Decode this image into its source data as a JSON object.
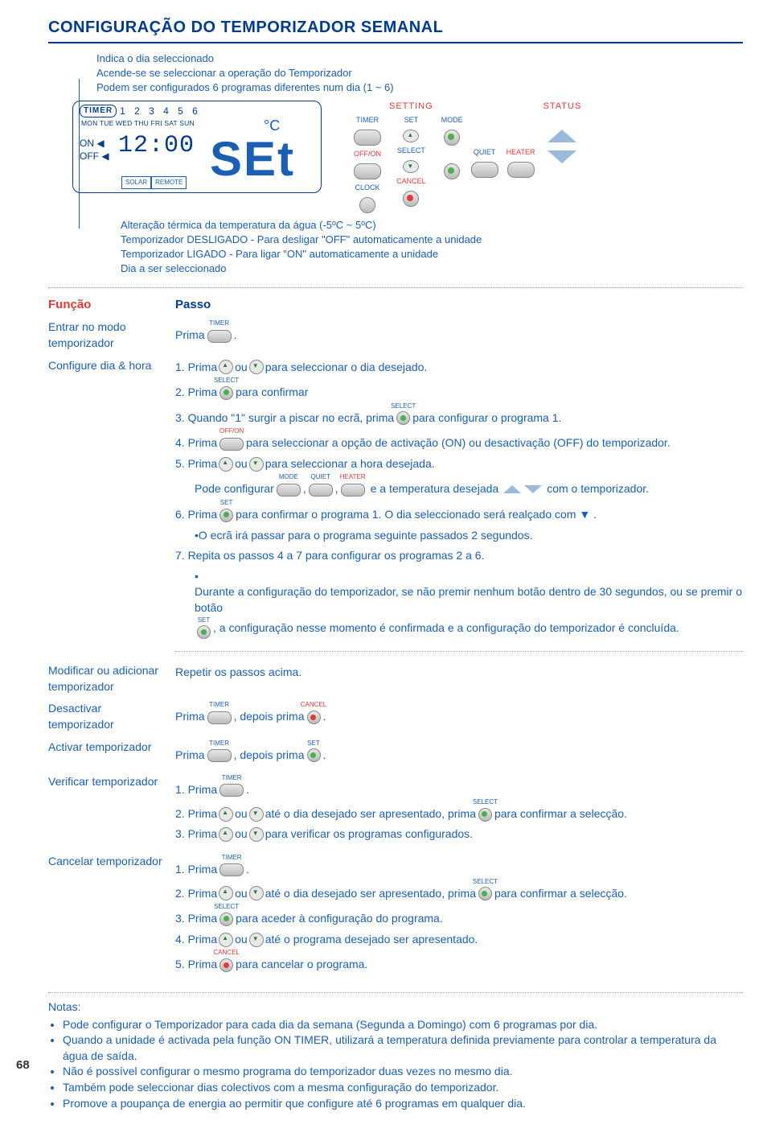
{
  "title": "CONFIGURAÇÃO DO TEMPORIZADOR SEMANAL",
  "annotations": {
    "a1": "Indica o dia seleccionado",
    "a2": "Acende-se se seleccionar a operação do Temporizador",
    "a3": "Podem ser configurados 6 programas diferentes num dia (1 ~ 6)",
    "b1": "Alteração térmica da temperatura da água (-5ºC ~ 5ºC)",
    "b2": "Temporizador DESLIGADO - Para desligar \"OFF\" automaticamente a unidade",
    "b3": "Temporizador LIGADO - Para ligar \"ON\" automaticamente a unidade",
    "b4": "Dia a ser seleccionado"
  },
  "lcd": {
    "timer_label": "TIMER",
    "programs": "1 2 3 4 5 6",
    "days": "MON TUE WED THU FRI SAT SUN",
    "on": "ON",
    "off": "OFF",
    "time": "12:00",
    "celsius_block": "0",
    "set_text": "SEt",
    "solar": "SOLAR",
    "remote": "REMOTE"
  },
  "cp": {
    "setting": "SETTING",
    "status": "STATUS",
    "timer": "TIMER",
    "set": "SET",
    "mode": "MODE",
    "offon": "OFF/ON",
    "select": "SELECT",
    "quiet": "QUIET",
    "heater": "HEATER",
    "clock": "CLOCK",
    "cancel": "CANCEL"
  },
  "headers": {
    "funcao": "Função",
    "passo": "Passo"
  },
  "rows": {
    "r1_label": "Entrar no modo temporizador",
    "r1_step": "Prima",
    "r1_end": ".",
    "r2_label": "Configure dia & hora",
    "r2_s1a": "1. Prima",
    "r2_s1b": "ou",
    "r2_s1c": "para seleccionar o dia desejado.",
    "r2_s2a": "2. Prima",
    "r2_s2b": "para confirmar",
    "r2_s3a": "3. Quando \"1\" surgir a piscar no ecrã, prima",
    "r2_s3b": "para configurar o programa 1.",
    "r2_s4a": "4. Prima",
    "r2_s4b": "para seleccionar a opção de activação (ON) ou desactivação (OFF) do temporizador.",
    "r2_s5a": "5. Prima",
    "r2_s5b": "ou",
    "r2_s5c": "para seleccionar a hora desejada.",
    "r2_s5d": "Pode configurar",
    "r2_s5e": ",",
    "r2_s5f": ",",
    "r2_s5g": "e a temperatura desejada",
    "r2_s5h": "com o temporizador.",
    "r2_s6a": "6. Prima",
    "r2_s6b": "para confirmar o programa 1. O dia seleccionado será realçado com ▼ .",
    "r2_s6c": "O ecrã irá passar para o programa seguinte passados 2 segundos.",
    "r2_s7": "7. Repita os passos 4 a 7 para configurar os programas 2 a 6.",
    "r2_s7b": "Durante a configuração do temporizador, se não premir nenhum botão dentro de 30 segundos, ou se premir o botão",
    "r2_s7c": ", a configuração nesse momento é confirmada e a configuração do temporizador é concluída.",
    "r3_label": "Modificar ou adicionar temporizador",
    "r3_step": "Repetir os passos acima.",
    "r4_label": "Desactivar temporizador",
    "r4_a": "Prima",
    "r4_b": ", depois prima",
    "r4_c": ".",
    "r5_label": "Activar temporizador",
    "r5_a": "Prima",
    "r5_b": ", depois prima",
    "r5_c": ".",
    "r6_label": "Verificar temporizador",
    "r6_s1": "1. Prima",
    "r6_s1b": ".",
    "r6_s2a": "2. Prima",
    "r6_s2b": "ou",
    "r6_s2c": "até o dia desejado ser apresentado, prima",
    "r6_s2d": "para confirmar a selecção.",
    "r6_s3a": "3. Prima",
    "r6_s3b": "ou",
    "r6_s3c": "para verificar os programas configurados.",
    "r7_label": "Cancelar temporizador",
    "r7_s1": "1. Prima",
    "r7_s1b": ".",
    "r7_s2a": "2. Prima",
    "r7_s2b": "ou",
    "r7_s2c": "até o dia desejado ser apresentado, prima",
    "r7_s2d": "para confirmar a selecção.",
    "r7_s3a": "3. Prima",
    "r7_s3b": "para aceder à configuração do programa.",
    "r7_s4a": "4. Prima",
    "r7_s4b": "ou",
    "r7_s4c": "até o programa desejado ser apresentado.",
    "r7_s5a": "5. Prima",
    "r7_s5b": "para cancelar o programa."
  },
  "notes": {
    "title": "Notas:",
    "n1": "Pode configurar o Temporizador para cada dia da semana (Segunda a Domingo) com 6 programas por dia.",
    "n2": "Quando a unidade é activada pela função ON TIMER, utilizará a temperatura definida previamente para controlar a temperatura da água de saída.",
    "n3": "Não é possível configurar o mesmo programa do temporizador duas vezes no mesmo dia.",
    "n4": "Também pode seleccionar dias colectivos com a mesma configuração do temporizador.",
    "n5": "Promove a poupança de energia ao permitir que configure até 6 programas em qualquer dia."
  },
  "page_num": "68"
}
